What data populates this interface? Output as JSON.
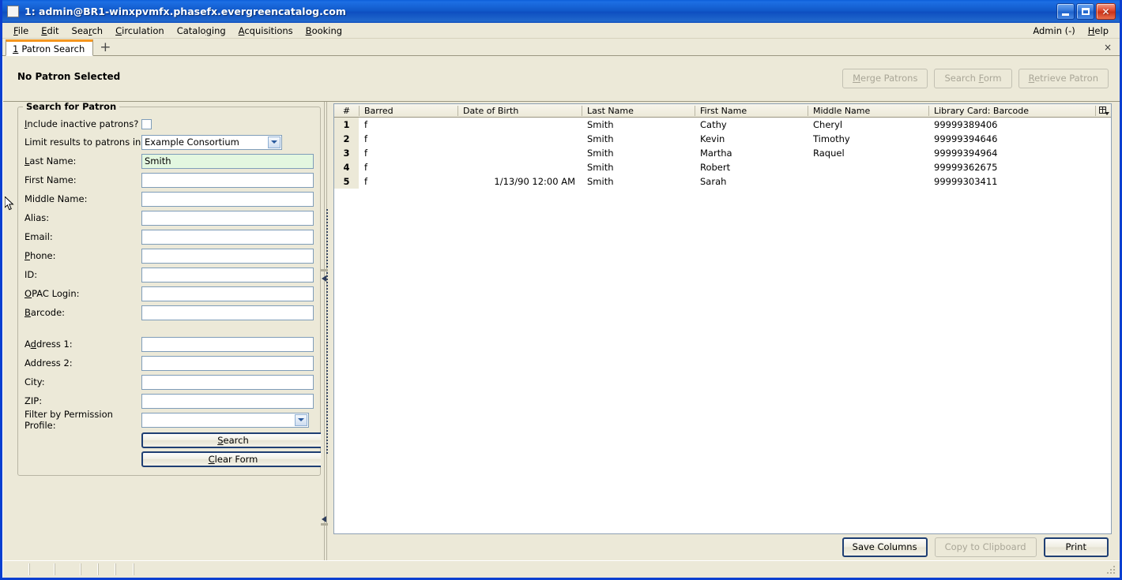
{
  "window": {
    "title": "1: admin@BR1-winxpvmfx.phasefx.evergreencatalog.com",
    "minimize_label": "Minimize",
    "maximize_label": "Maximize",
    "close_label": "Close",
    "accent_titlebar": "#0d5fd8",
    "accent_close": "#cc3318"
  },
  "menubar": {
    "items": [
      {
        "label": "File",
        "accel": "F"
      },
      {
        "label": "Edit",
        "accel": "E"
      },
      {
        "label": "Search",
        "accel": "r"
      },
      {
        "label": "Circulation",
        "accel": "C"
      },
      {
        "label": "Cataloging",
        "accel": "g"
      },
      {
        "label": "Acquisitions",
        "accel": "A"
      },
      {
        "label": "Booking",
        "accel": "B"
      }
    ],
    "right": [
      {
        "label": "Admin (-)",
        "accel": ""
      },
      {
        "label": "Help",
        "accel": "H"
      }
    ]
  },
  "tabs": {
    "active": {
      "number": "1",
      "label": "Patron Search"
    },
    "add_label": "+",
    "close_label": "×"
  },
  "patron_header": {
    "title": "No Patron Selected",
    "buttons": [
      {
        "id": "merge-patrons",
        "label": "Merge Patrons",
        "accel": "M",
        "disabled": true
      },
      {
        "id": "search-form",
        "label": "Search Form",
        "accel": "F",
        "disabled": true
      },
      {
        "id": "retrieve-patron",
        "label": "Retrieve Patron",
        "accel": "R",
        "disabled": true
      }
    ]
  },
  "search_form": {
    "legend": "Search for Patron",
    "include_inactive_label": "Include inactive patrons?",
    "include_inactive_accel": "I",
    "include_inactive_checked": false,
    "limit_label": "Limit results to patrons in",
    "limit_value": "Example Consortium",
    "fields": [
      {
        "id": "last-name",
        "label": "Last Name:",
        "accel": "L",
        "value": "Smith",
        "focused": true
      },
      {
        "id": "first-name",
        "label": "First Name:",
        "accel": "",
        "value": "",
        "focused": false
      },
      {
        "id": "middle-name",
        "label": "Middle Name:",
        "accel": "",
        "value": "",
        "focused": false
      },
      {
        "id": "alias",
        "label": "Alias:",
        "accel": "",
        "value": "",
        "focused": false
      },
      {
        "id": "email",
        "label": "Email:",
        "accel": "",
        "value": "",
        "focused": false
      },
      {
        "id": "phone",
        "label": "Phone:",
        "accel": "P",
        "value": "",
        "focused": false
      },
      {
        "id": "patron-id",
        "label": "ID:",
        "accel": "",
        "value": "",
        "focused": false
      },
      {
        "id": "opac-login",
        "label": "OPAC Login:",
        "accel": "O",
        "value": "",
        "focused": false
      },
      {
        "id": "barcode",
        "label": "Barcode:",
        "accel": "B",
        "value": "",
        "focused": false
      }
    ],
    "address_fields": [
      {
        "id": "address-1",
        "label": "Address 1:",
        "accel": "d",
        "value": ""
      },
      {
        "id": "address-2",
        "label": "Address 2:",
        "accel": "",
        "value": ""
      },
      {
        "id": "city",
        "label": "City:",
        "accel": "",
        "value": ""
      },
      {
        "id": "zip",
        "label": "ZIP:",
        "accel": "",
        "value": ""
      }
    ],
    "permission_label": "Filter by Permission Profile:",
    "permission_value": "",
    "search_button": "Search",
    "search_accel": "S",
    "clear_button": "Clear Form",
    "clear_accel": "C"
  },
  "results": {
    "columns": [
      "#",
      "Barred",
      "Date of Birth",
      "Last Name",
      "First Name",
      "Middle Name",
      "Library Card: Barcode"
    ],
    "column_picker_label": "Column Picker",
    "rows": [
      {
        "num": "1",
        "barred": "f",
        "dob": "",
        "last": "Smith",
        "first": "Cathy",
        "middle": "Cheryl",
        "barcode": "99999389406"
      },
      {
        "num": "2",
        "barred": "f",
        "dob": "",
        "last": "Smith",
        "first": "Kevin",
        "middle": "Timothy",
        "barcode": "99999394646"
      },
      {
        "num": "3",
        "barred": "f",
        "dob": "",
        "last": "Smith",
        "first": "Martha",
        "middle": "Raquel",
        "barcode": "99999394964"
      },
      {
        "num": "4",
        "barred": "f",
        "dob": "",
        "last": "Smith",
        "first": "Robert",
        "middle": "",
        "barcode": "99999362675"
      },
      {
        "num": "5",
        "barred": "f",
        "dob": "1/13/90 12:00 AM",
        "last": "Smith",
        "first": "Sarah",
        "middle": "",
        "barcode": "99999303411"
      }
    ],
    "footer_buttons": [
      {
        "id": "save-columns",
        "label": "Save Columns",
        "disabled": false,
        "strong": true
      },
      {
        "id": "copy-to-clipboard",
        "label": "Copy to Clipboard",
        "disabled": true,
        "strong": false
      },
      {
        "id": "print",
        "label": "Print",
        "disabled": false,
        "strong": true
      }
    ]
  },
  "statusbar": {
    "segments": [
      "",
      "",
      "",
      "",
      "",
      "",
      ""
    ]
  }
}
